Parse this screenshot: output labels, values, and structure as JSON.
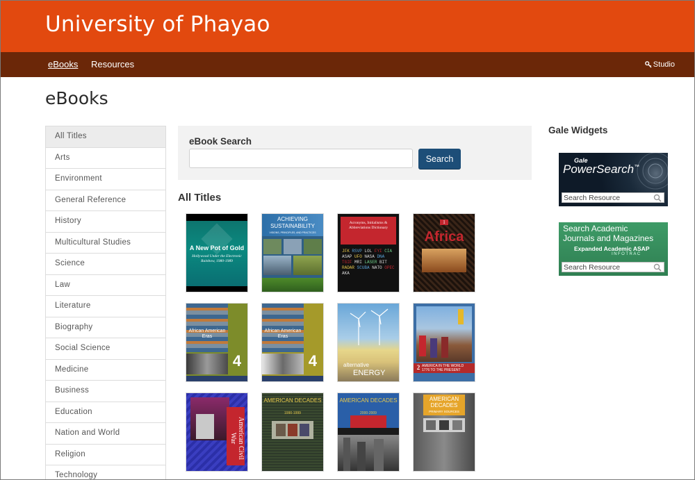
{
  "header": {
    "title": "University of Phayao"
  },
  "nav": {
    "ebooks": "eBooks",
    "resources": "Resources",
    "studio": "Studio"
  },
  "page": {
    "title": "eBooks"
  },
  "sidebar": {
    "items": [
      {
        "label": "All Titles"
      },
      {
        "label": "Arts"
      },
      {
        "label": "Environment"
      },
      {
        "label": "General Reference"
      },
      {
        "label": "History"
      },
      {
        "label": "Multicultural Studies"
      },
      {
        "label": "Science"
      },
      {
        "label": "Law"
      },
      {
        "label": "Literature"
      },
      {
        "label": "Biography"
      },
      {
        "label": "Social Science"
      },
      {
        "label": "Medicine"
      },
      {
        "label": "Business"
      },
      {
        "label": "Education"
      },
      {
        "label": "Nation and World"
      },
      {
        "label": "Religion"
      },
      {
        "label": "Technology"
      }
    ]
  },
  "search": {
    "label": "eBook Search",
    "value": "",
    "button": "Search"
  },
  "titles": {
    "heading": "All Titles",
    "books": [
      {
        "title": "A New Pot of Gold",
        "subtitle": "Hollywood Under the Electronic Rainbow, 1980-1989"
      },
      {
        "title": "ACHIEVING SUSTAINABILITY",
        "subtitle": "VISIONS, PRINCIPLES, AND PRACTICES"
      },
      {
        "title": "Acronyms, Initialisms & Abbreviations Dictionary"
      },
      {
        "title": "Africa",
        "volume": "1"
      },
      {
        "title": "African American Eras",
        "volume": "4"
      },
      {
        "title": "African American Eras",
        "volume": "4"
      },
      {
        "title": "alternative",
        "subtitle": "ENERGY"
      },
      {
        "title": "AMERICA IN THE WORLD",
        "subtitle": "1776 TO THE PRESENT",
        "volume": "2"
      },
      {
        "title": "American Civil War"
      },
      {
        "title": "AMERICAN DECADES",
        "subtitle": "1990-1999"
      },
      {
        "title": "AMERICAN DECADES",
        "subtitle": "2000-2009"
      },
      {
        "title": "AMERICAN DECADES",
        "subtitle": "PRIMARY SOURCES"
      }
    ]
  },
  "widgets": {
    "title": "Gale Widgets",
    "powersearch": {
      "brand_small": "Gale",
      "brand": "PowerSearch",
      "tm": "™",
      "placeholder": "Search Resource"
    },
    "academic": {
      "line1": "Search Academic",
      "line2": "Journals and Magazines",
      "line3": "Expanded Academic ASAP",
      "line4": "INFOTRAC",
      "placeholder": "Search Resource"
    }
  },
  "colors": {
    "header": "#e2490f",
    "nav": "#6b2708",
    "button": "#1d4e78"
  }
}
